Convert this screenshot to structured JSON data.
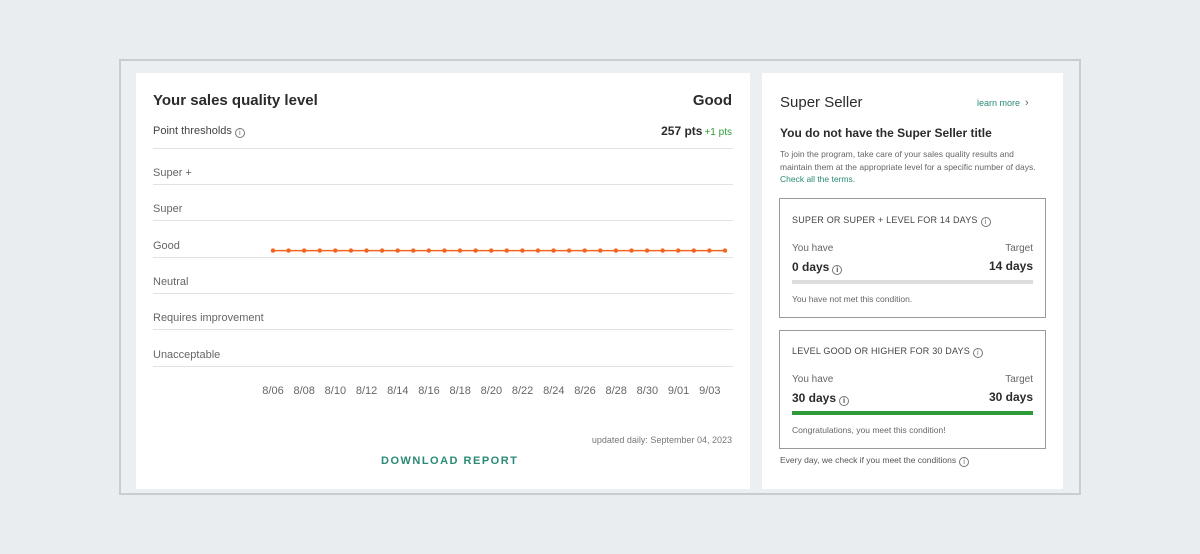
{
  "quality": {
    "title": "Your sales quality level",
    "level": "Good",
    "thresholds_label": "Point thresholds",
    "points": "257 pts",
    "points_delta": "+1 pts",
    "rows": [
      "Super +",
      "Super",
      "Good",
      "Neutral",
      "Requires improvement",
      "Unacceptable"
    ],
    "ticks": [
      "8/06",
      "8/08",
      "8/10",
      "8/12",
      "8/14",
      "8/16",
      "8/18",
      "8/20",
      "8/22",
      "8/24",
      "8/26",
      "8/28",
      "8/30",
      "9/01",
      "9/03"
    ],
    "updated": "updated daily: September 04, 2023",
    "download": "DOWNLOAD REPORT"
  },
  "chart_data": {
    "type": "line",
    "series": [
      {
        "values": [
          "Good",
          "Good",
          "Good",
          "Good",
          "Good",
          "Good",
          "Good",
          "Good",
          "Good",
          "Good",
          "Good",
          "Good",
          "Good",
          "Good",
          "Good",
          "Good",
          "Good",
          "Good",
          "Good",
          "Good",
          "Good",
          "Good",
          "Good",
          "Good",
          "Good",
          "Good",
          "Good",
          "Good",
          "Good",
          "Good"
        ]
      }
    ],
    "categories_label_ticks": [
      "8/06",
      "8/08",
      "8/10",
      "8/12",
      "8/14",
      "8/16",
      "8/18",
      "8/20",
      "8/22",
      "8/24",
      "8/26",
      "8/28",
      "8/30",
      "9/01",
      "9/03"
    ],
    "y_levels": [
      "Super +",
      "Super",
      "Good",
      "Neutral",
      "Requires improvement",
      "Unacceptable"
    ],
    "color": "#f06520",
    "grid": true
  },
  "superseller": {
    "title": "Super Seller",
    "learn_more": "learn more",
    "status": "You do not have the Super Seller title",
    "description": "To join the program, take care of your sales quality results and maintain them at the appropriate level for a specific number of days.",
    "terms_link": "Check all the terms.",
    "cards": [
      {
        "heading": "SUPER OR SUPER + LEVEL FOR 14 DAYS",
        "have_label": "You have",
        "have_value": "0 days",
        "target_label": "Target",
        "target_value": "14 days",
        "progress": 0,
        "note": "You have not met this condition."
      },
      {
        "heading": "LEVEL GOOD OR HIGHER FOR 30 DAYS",
        "have_label": "You have",
        "have_value": "30 days",
        "target_label": "Target",
        "target_value": "30 days",
        "progress": 1,
        "note": "Congratulations, you meet this condition!"
      }
    ],
    "footer": "Every day, we check if you meet the conditions"
  },
  "colors": {
    "accent": "#2a8a76",
    "success": "#2e9b3a",
    "line": "#f06520"
  }
}
